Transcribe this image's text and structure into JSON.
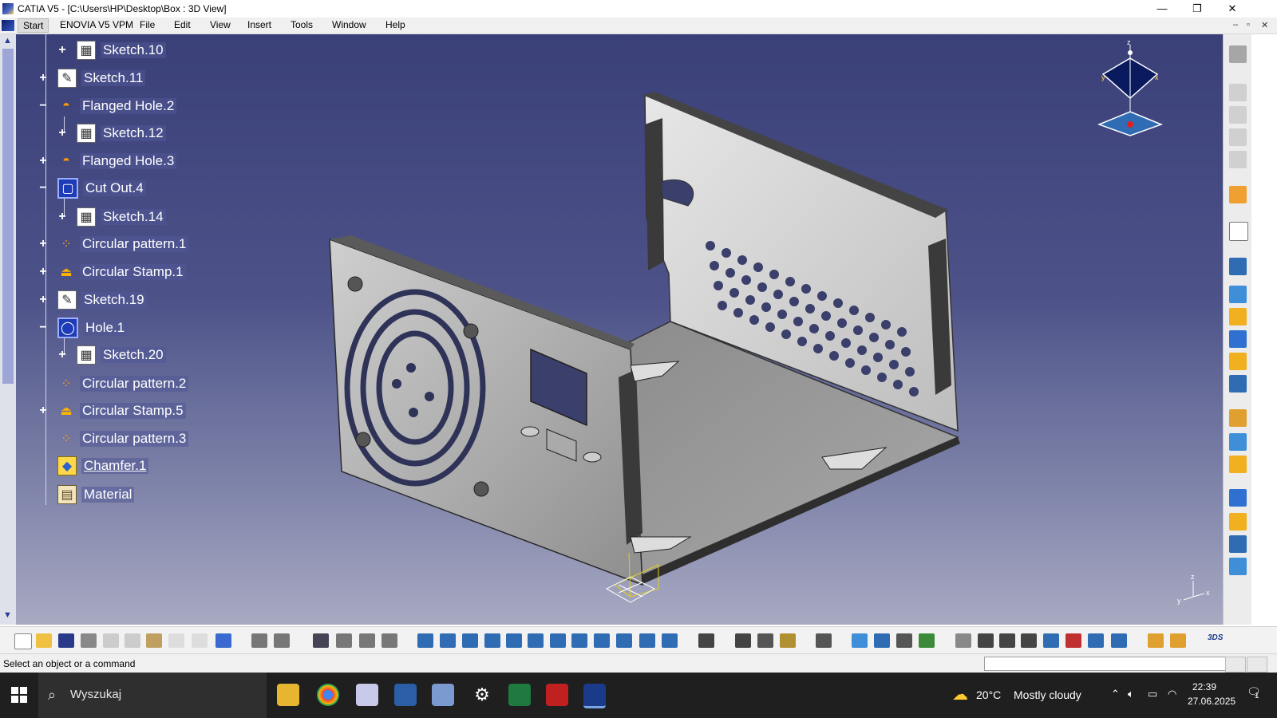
{
  "window": {
    "title": "CATIA V5 - [C:\\Users\\HP\\Desktop\\Box : 3D View]",
    "minimize": "—",
    "restore": "❐",
    "close": "✕"
  },
  "menubar": {
    "items": [
      "Start",
      "ENOVIA V5 VPM",
      "File",
      "Edit",
      "View",
      "Insert",
      "Tools",
      "Window",
      "Help"
    ],
    "doc_controls": [
      "–",
      "▫",
      "✕"
    ]
  },
  "tree": {
    "items": [
      {
        "label": "Sketch.10",
        "icon": "sketch-icon",
        "expander": "+"
      },
      {
        "label": "Sketch.11",
        "icon": "sketch-icon",
        "expander": "+"
      },
      {
        "label": "Flanged Hole.2",
        "icon": "flanged-hole-icon",
        "expander": "−"
      },
      {
        "label": "Sketch.12",
        "icon": "sketch-icon",
        "expander": "+"
      },
      {
        "label": "Flanged Hole.3",
        "icon": "flanged-hole-icon",
        "expander": "+"
      },
      {
        "label": "Cut Out.4",
        "icon": "cut-out-icon",
        "expander": "−"
      },
      {
        "label": "Sketch.14",
        "icon": "sketch-icon",
        "expander": "+"
      },
      {
        "label": "Circular pattern.1",
        "icon": "circular-pattern-icon",
        "expander": "+"
      },
      {
        "label": "Circular Stamp.1",
        "icon": "circular-stamp-icon",
        "expander": "+"
      },
      {
        "label": "Sketch.19",
        "icon": "sketch-icon",
        "expander": "+"
      },
      {
        "label": "Hole.1",
        "icon": "hole-icon",
        "expander": "−"
      },
      {
        "label": "Sketch.20",
        "icon": "sketch-icon",
        "expander": "+"
      },
      {
        "label": "Circular pattern.2",
        "icon": "circular-pattern-icon",
        "expander": ""
      },
      {
        "label": "Circular Stamp.5",
        "icon": "circular-stamp-icon",
        "expander": "+"
      },
      {
        "label": "Circular pattern.3",
        "icon": "circular-pattern-icon",
        "expander": ""
      },
      {
        "label": "Chamfer.1",
        "icon": "chamfer-icon",
        "expander": ""
      },
      {
        "label": "Material",
        "icon": "material-icon",
        "expander": ""
      }
    ]
  },
  "compass": {
    "x": "x",
    "y": "y",
    "z": "z"
  },
  "axis_triad": {
    "x": "x",
    "y": "y",
    "z": "z"
  },
  "statusbar": {
    "message": "Select an object or a command",
    "command_input": ""
  },
  "taskbar": {
    "search_placeholder": "Wyszukaj",
    "weather_temp": "20°C",
    "weather_text": "Mostly cloudy",
    "time": "22:39",
    "date": "27.06.2025",
    "notification_count": "1"
  },
  "colors": {
    "viewport_top": "#3a3f78",
    "viewport_bottom": "#a8aac2",
    "tree_label_bg": "#505896",
    "scrollbar_thumb": "#9ea6d8"
  }
}
